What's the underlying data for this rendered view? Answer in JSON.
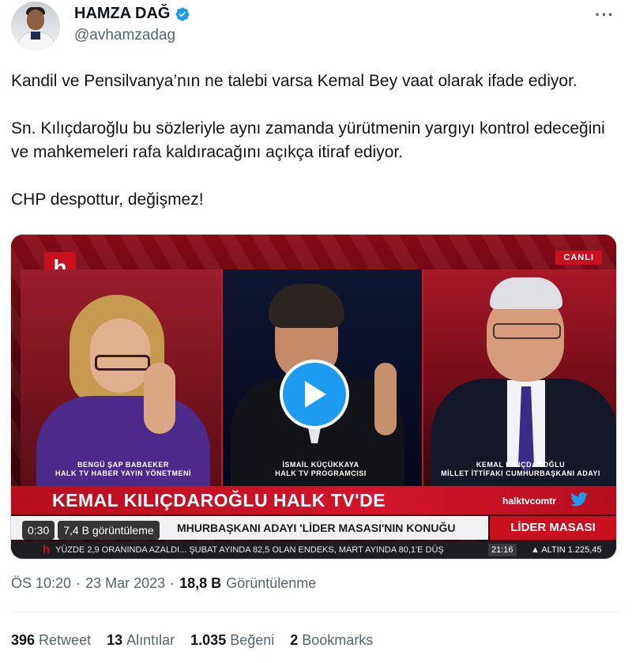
{
  "author": {
    "display_name": "HAMZA DAĞ",
    "handle": "@avhamzadag",
    "verified": true,
    "avatar_icon": "user-avatar"
  },
  "more_icon": "more-horizontal-icon",
  "tweet": {
    "paragraphs": [
      "Kandil ve Pensilvanya’nın ne talebi varsa Kemal Bey vaat olarak ifade ediyor.",
      "Sn. Kılıçdaroğlu bu sözleriyle aynı zamanda yürütmenin yargıyı kontrol edeceğini ve mahkemeleri rafa kaldıracağını açıkça itiraf ediyor.",
      "CHP despottur, değişmez!"
    ]
  },
  "video": {
    "channel_logo": "h",
    "live_badge": "CANLI",
    "guests": [
      {
        "name": "BENGÜ ŞAP BABAEKER",
        "title": "HALK TV HABER YAYIN YÖNETMENİ"
      },
      {
        "name": "İSMAİL KÜÇÜKKAYA",
        "title": "HALK TV PROGRAMCISI"
      },
      {
        "name": "KEMAL KILIÇDAROĞLU",
        "title": "MİLLET İTTİFAKI CUMHURBAŞKANI ADAYI"
      }
    ],
    "headline": "KEMAL KILIÇDAROĞLU HALK TV'DE",
    "site": "halktvcomtr",
    "subline": "MHURBAŞKANI ADAYI 'LİDER MASASI'NIN KONUĞU",
    "program": "LİDER MASASI",
    "ticker_logo": "h",
    "ticker_text": "YÜZDE 2,9 ORANINDA AZALDI...   ŞUBAT AYINDA 82,5 OLAN ENDEKS, MART AYINDA 80,1'E DÜŞ",
    "ticker_time": "21:16",
    "ticker_market": "▲ ALTIN 1.225,45",
    "duration": "0:30",
    "view_count": "7,4 B görüntüleme",
    "play_icon": "play-icon"
  },
  "meta": {
    "time": "ÖS 10:20",
    "date": "23 Mar 2023",
    "separator": "·",
    "views_count": "18,8 B",
    "views_label": "Görüntülenme"
  },
  "stats": [
    {
      "count": "396",
      "label": "Retweet"
    },
    {
      "count": "13",
      "label": "Alıntılar"
    },
    {
      "count": "1.035",
      "label": "Beğeni"
    },
    {
      "count": "2",
      "label": "Bookmarks"
    }
  ],
  "colors": {
    "accent": "#1d9bf0",
    "text": "#0f1419",
    "secondary": "#536471",
    "channel_red": "#c8101e"
  }
}
